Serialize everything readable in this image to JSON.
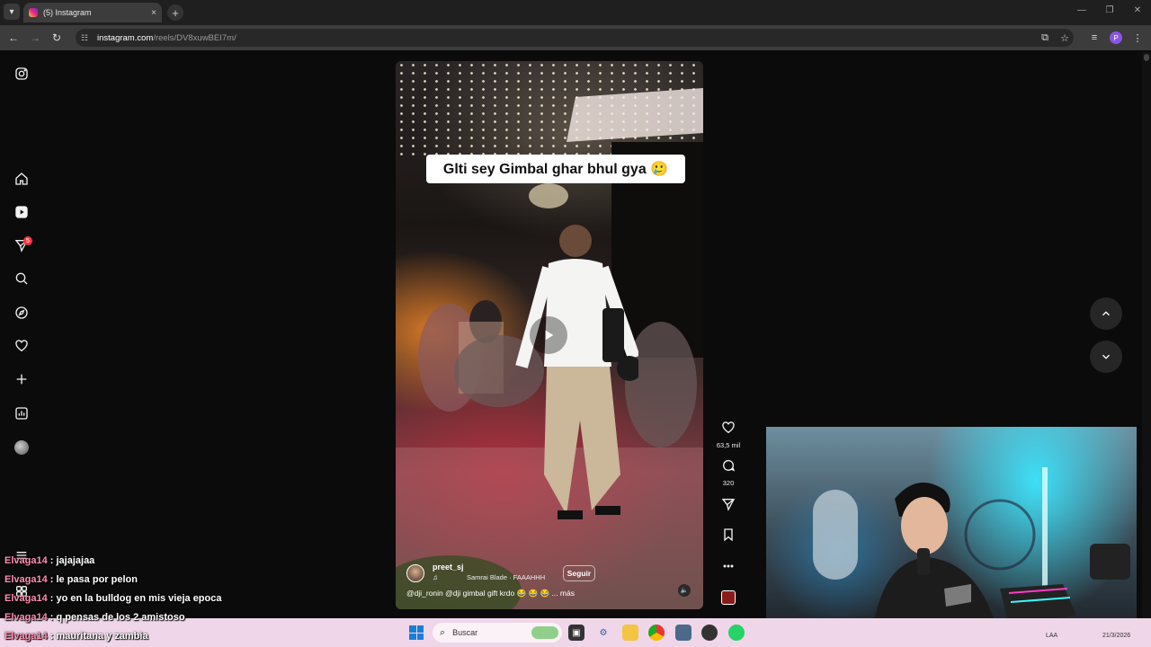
{
  "browser": {
    "tab_title": "(5) Instagram",
    "tab_close": "×",
    "new_tab": "+",
    "url_host": "instagram.com",
    "url_path": "/reels/DV8xuwBEI7m/",
    "profile_initial": "P"
  },
  "sidebar": {
    "notification_count": "5",
    "items": [
      "instagram-logo",
      "home",
      "reels",
      "messages",
      "search",
      "explore",
      "notifications",
      "create",
      "dashboard",
      "profile",
      "more"
    ]
  },
  "reel": {
    "overlay_text": "Glti sey Gimbal ghar bhul gya 🥲",
    "author": "preet_sj",
    "music_note": "♫",
    "music": "Samrai Blade · FAAAHHH",
    "follow_label": "Seguir",
    "description": "@dji_ronin @dji gimbal gift krdo 😂 😂 😂 ... más",
    "likes": "63,5 mil",
    "comments": "320"
  },
  "chat": [
    {
      "user": "Elvaga14",
      "msg": ": jajajajaa"
    },
    {
      "user": "Elvaga14",
      "msg": ": le pasa por pelon"
    },
    {
      "user": "Elvaga14",
      "msg": ": yo en la bulldog en mis vieja epoca"
    },
    {
      "user": "Elvaga14",
      "msg": ": q pensas de los 2 amistoso"
    },
    {
      "user": "Elvaga14",
      "msg": ": mauritana y zambia"
    }
  ],
  "taskbar": {
    "search_placeholder": "Buscar",
    "lang": "LAA",
    "date": "21/3/2026"
  },
  "colors": {
    "chat_user": "#ff8fb0",
    "notif_badge": "#ff3040",
    "taskbar": "#efd6e9"
  }
}
